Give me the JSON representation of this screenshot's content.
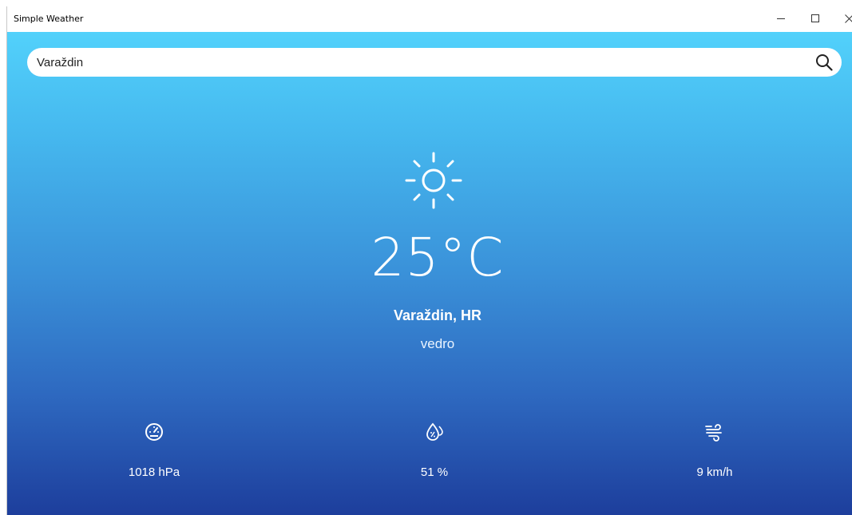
{
  "window": {
    "title": "Simple Weather",
    "controls": [
      "minimize",
      "maximize",
      "close"
    ]
  },
  "search": {
    "value": "Varaždin",
    "placeholder": "",
    "icon": "search-icon"
  },
  "current": {
    "icon": "sun-icon",
    "temperature": "25°C",
    "location": "Varaždin, HR",
    "description": "vedro"
  },
  "stats": [
    {
      "icon": "pressure-gauge-icon",
      "value": "1018 hPa"
    },
    {
      "icon": "humidity-drop-icon",
      "value": "51 %"
    },
    {
      "icon": "wind-icon",
      "value": "9 km/h"
    }
  ],
  "colors": {
    "gradient_top": "#52d1fb",
    "gradient_bottom": "#1d3e9c",
    "text": "#ffffff"
  }
}
